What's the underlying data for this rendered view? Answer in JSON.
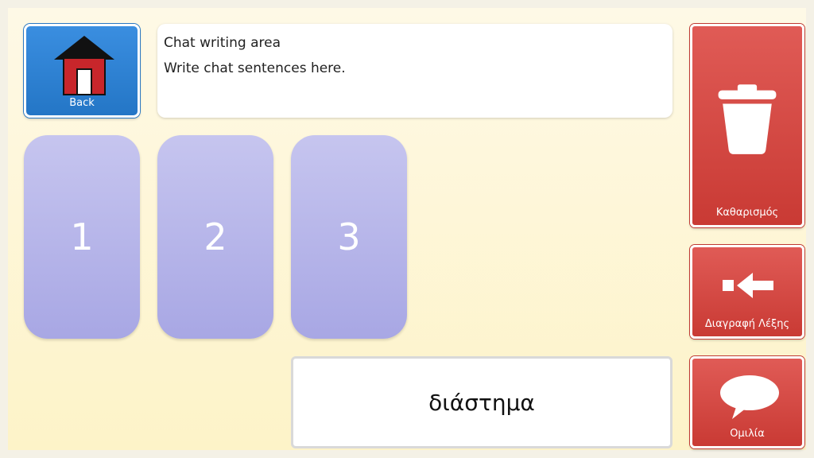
{
  "back": {
    "label": "Back"
  },
  "chat": {
    "title": "Chat writing area",
    "hint": "Write chat sentences here."
  },
  "numbers": [
    "1",
    "2",
    "3"
  ],
  "actions": {
    "clear_label": "Καθαρισμός",
    "delete_word_label": "Διαγραφή Λέξης",
    "speak_label": "Ομιλία"
  },
  "space_label": "διάστημα",
  "colors": {
    "back_blue": "#2f86d8",
    "action_red": "#d5473f",
    "number_purple": "#b6b5ea",
    "background": "#fdf5d3"
  }
}
